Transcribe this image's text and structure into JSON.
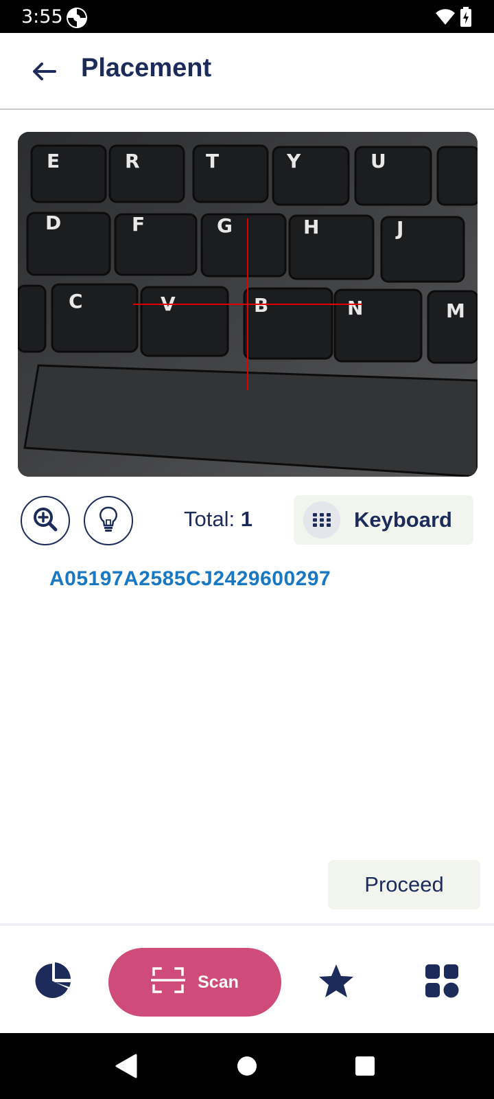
{
  "status_bar": {
    "time": "3:55",
    "icons": [
      "app-notification-icon",
      "wifi-icon",
      "battery-charging-icon"
    ]
  },
  "header": {
    "back_icon": "arrow-left-icon",
    "title": "Placement"
  },
  "scanner": {
    "preview_description_icon": "camera-preview",
    "zoom_icon": "zoom-in-icon",
    "light_icon": "lightbulb-icon",
    "total_label": "Total:",
    "total_value": "1",
    "keyboard_icon": "keypad-icon",
    "keyboard_label": "Keyboard"
  },
  "scanned_codes": [
    "A05197A2585CJ2429600297"
  ],
  "actions": {
    "proceed_label": "Proceed"
  },
  "bottom_nav": {
    "items": [
      {
        "icon": "pie-chart-icon"
      },
      {
        "icon": "scan-frame-icon",
        "label": "Scan",
        "active": true
      },
      {
        "icon": "star-icon"
      },
      {
        "icon": "grid-icon"
      }
    ]
  },
  "colors": {
    "primary": "#1d2b5a",
    "accent": "#cf4b79",
    "code": "#1878c4",
    "soft_bg": "#f1f5ee"
  }
}
